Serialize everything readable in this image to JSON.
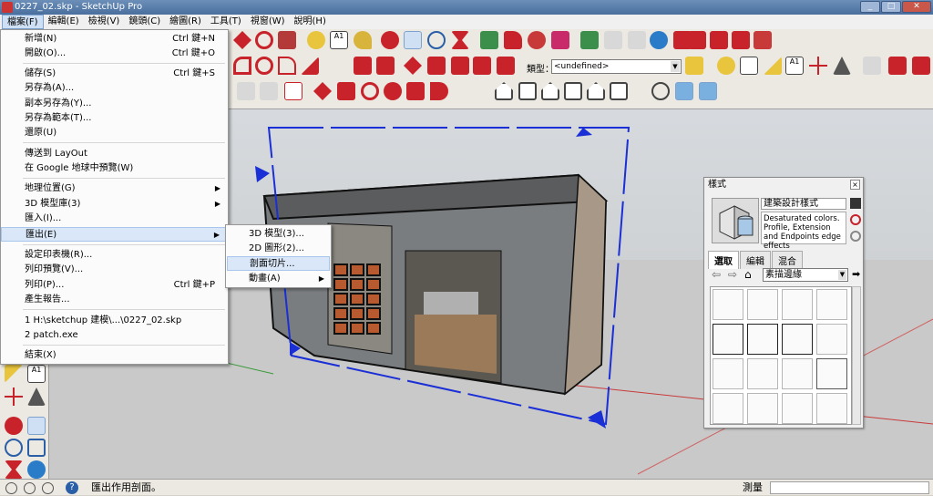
{
  "window": {
    "title": "0227_02.skp - SketchUp Pro"
  },
  "menubar": [
    "檔案(F)",
    "編輯(E)",
    "檢視(V)",
    "鏡頭(C)",
    "繪圖(R)",
    "工具(T)",
    "視窗(W)",
    "說明(H)"
  ],
  "toolbar": {
    "type_label": "類型：",
    "type_value": "<undefined>"
  },
  "file_menu": [
    {
      "label": "新增(N)",
      "shortcut": "Ctrl 鍵+N"
    },
    {
      "label": "開啟(O)...",
      "shortcut": "Ctrl 鍵+O"
    },
    {
      "label": "儲存(S)",
      "shortcut": "Ctrl 鍵+S"
    },
    {
      "label": "另存為(A)...",
      "shortcut": ""
    },
    {
      "label": "副本另存為(Y)...",
      "shortcut": ""
    },
    {
      "label": "另存為範本(T)...",
      "shortcut": ""
    },
    {
      "label": "還原(U)",
      "shortcut": ""
    },
    {
      "label": "傳送到 LayOut",
      "shortcut": ""
    },
    {
      "label": "在 Google 地球中預覽(W)",
      "shortcut": ""
    },
    {
      "label": "地理位置(G)",
      "shortcut": ""
    },
    {
      "label": "3D 模型庫(3)",
      "shortcut": ""
    },
    {
      "label": "匯入(I)...",
      "shortcut": ""
    },
    {
      "label": "匯出(E)",
      "shortcut": ""
    },
    {
      "label": "設定印表機(R)...",
      "shortcut": ""
    },
    {
      "label": "列印預覽(V)...",
      "shortcut": ""
    },
    {
      "label": "列印(P)...",
      "shortcut": "Ctrl 鍵+P"
    },
    {
      "label": "產生報告...",
      "shortcut": ""
    },
    {
      "label": "1 H:\\sketchup 建模\\...\\0227_02.skp",
      "shortcut": ""
    },
    {
      "label": "2 patch.exe",
      "shortcut": ""
    },
    {
      "label": "結束(X)",
      "shortcut": ""
    }
  ],
  "export_submenu": [
    "3D 模型(3)...",
    "2D 圖形(2)...",
    "剖面切片...",
    "動畫(A)"
  ],
  "styles_panel": {
    "title": "樣式",
    "style_name": "建築設計樣式",
    "description": "Desaturated colors. Profile, Extension and Endpoints edge effects",
    "tabs": [
      "選取",
      "編輯",
      "混合"
    ],
    "collection": "素描邊緣"
  },
  "status": {
    "text": "匯出作用剖面。",
    "measure_label": "測量"
  },
  "colors": {
    "accent": "#3b6fc9",
    "section_blue": "#1a2fd6"
  }
}
